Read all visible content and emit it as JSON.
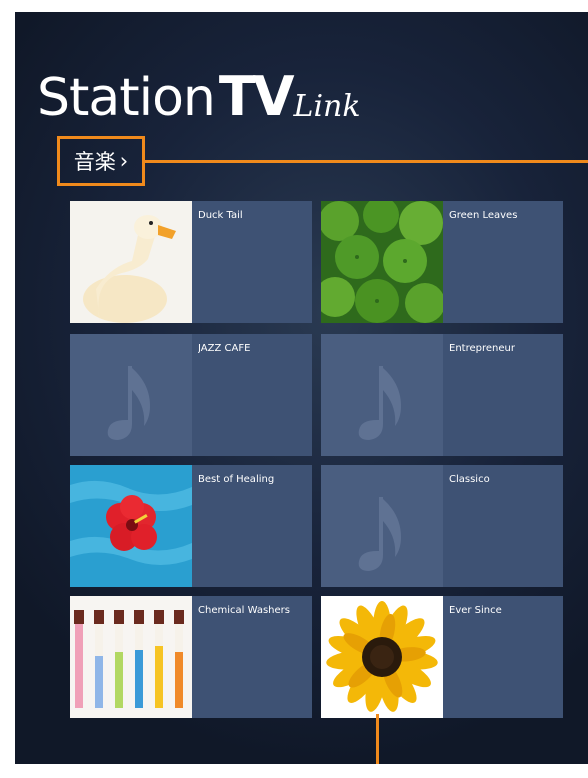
{
  "logo": {
    "station": "Station",
    "tv": "TV",
    "link": "Link"
  },
  "section": {
    "label": "音楽",
    "chevron": "›"
  },
  "albums": [
    {
      "title": "Duck Tail",
      "art": "duck-photo"
    },
    {
      "title": "Green Leaves",
      "art": "green-leaves-photo"
    },
    {
      "title": "JAZZ CAFE",
      "art": "music-note-placeholder"
    },
    {
      "title": "Entrepreneur",
      "art": "music-note-placeholder"
    },
    {
      "title": "Best of Healing",
      "art": "hibiscus-water-photo"
    },
    {
      "title": "Classico",
      "art": "music-note-placeholder"
    },
    {
      "title": "Chemical Washers",
      "art": "test-tubes-photo"
    },
    {
      "title": "Ever Since",
      "art": "sunflower-photo"
    }
  ],
  "colors": {
    "accent": "#f08a1c",
    "tile": "#3e5274",
    "background": "#18233a"
  }
}
